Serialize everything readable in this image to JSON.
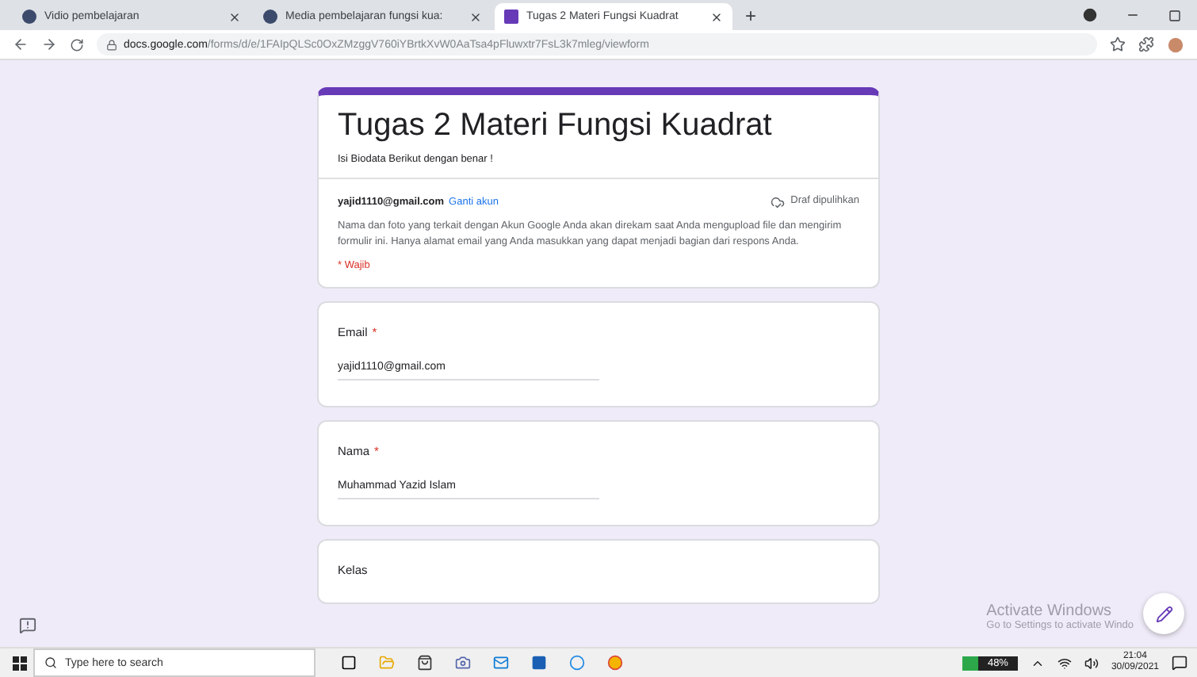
{
  "browser": {
    "tabs": [
      {
        "title": "Vidio pembelajaran",
        "selected": false,
        "kind": "site"
      },
      {
        "title": "Media pembelajaran fungsi kua:",
        "selected": false,
        "kind": "site"
      },
      {
        "title": "Tugas 2 Materi Fungsi Kuadrat",
        "selected": true,
        "kind": "forms"
      }
    ],
    "new_tab": "+",
    "url_host": "docs.google.com",
    "url_path": "/forms/d/e/1FAIpQLSc0OxZMzggV760iYBrtkXvW0AaTsa4pFluwxtr7FsL3k7mleg/viewform"
  },
  "form": {
    "title": "Tugas 2 Materi Fungsi Kuadrat",
    "description": "Isi Biodata Berikut dengan benar !",
    "account": "yajid1110@gmail.com",
    "switch_account": "Ganti akun",
    "draft_status": "Draf dipulihkan",
    "notice": "Nama dan foto yang terkait dengan Akun Google Anda akan direkam saat Anda mengupload file dan mengirim formulir ini. Hanya alamat email yang Anda masukkan yang dapat menjadi bagian dari respons Anda.",
    "required_note": "* Wajib",
    "required_symbol": "*",
    "questions": [
      {
        "label": "Email",
        "required": true,
        "value": "yajid1110@gmail.com"
      },
      {
        "label": "Nama",
        "required": true,
        "value": "Muhammad Yazid Islam"
      },
      {
        "label": "Kelas",
        "required": false
      }
    ]
  },
  "activation": {
    "title": "Activate Windows",
    "hint": "Go to Settings to activate Windo"
  },
  "taskbar": {
    "search_placeholder": "Type here to search",
    "battery": "48%",
    "time": "21:04",
    "date": "30/09/2021"
  }
}
